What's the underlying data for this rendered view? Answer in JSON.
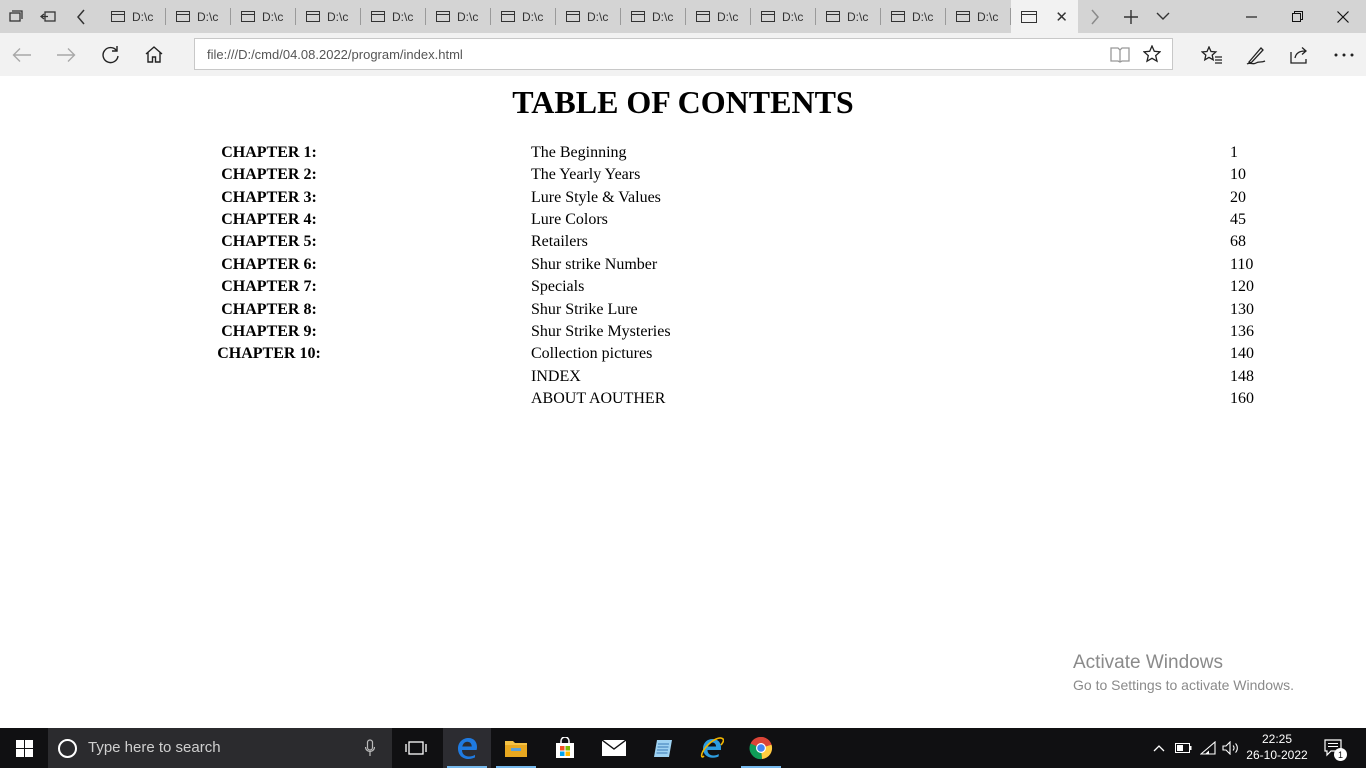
{
  "browser": {
    "tabs": [
      {
        "title": "D:\\c"
      },
      {
        "title": "D:\\c"
      },
      {
        "title": "D:\\c"
      },
      {
        "title": "D:\\c"
      },
      {
        "title": "D:\\c"
      },
      {
        "title": "D:\\c"
      },
      {
        "title": "D:\\c"
      },
      {
        "title": "D:\\c"
      },
      {
        "title": "D:\\c"
      },
      {
        "title": "D:\\c"
      },
      {
        "title": "D:\\c"
      },
      {
        "title": "D:\\c"
      },
      {
        "title": "D:\\c"
      },
      {
        "title": "D:\\c"
      }
    ],
    "active_tab_title": "",
    "address_url": "file:///D:/cmd/04.08.2022/program/index.html"
  },
  "page": {
    "title": "TABLE OF CONTENTS",
    "entries": [
      {
        "chapter": "CHAPTER 1:",
        "title": "The Beginning",
        "page": "1"
      },
      {
        "chapter": "CHAPTER 2:",
        "title": "The Yearly Years",
        "page": "10"
      },
      {
        "chapter": "CHAPTER 3:",
        "title": "Lure Style & Values",
        "page": "20"
      },
      {
        "chapter": "CHAPTER 4:",
        "title": "Lure Colors",
        "page": "45"
      },
      {
        "chapter": "CHAPTER 5:",
        "title": "Retailers",
        "page": "68"
      },
      {
        "chapter": "CHAPTER 6:",
        "title": "Shur strike Number",
        "page": "110"
      },
      {
        "chapter": "CHAPTER 7:",
        "title": "Specials",
        "page": "120"
      },
      {
        "chapter": "CHAPTER 8:",
        "title": "Shur Strike Lure",
        "page": "130"
      },
      {
        "chapter": "CHAPTER 9:",
        "title": "Shur Strike Mysteries",
        "page": "136"
      },
      {
        "chapter": "CHAPTER 10:",
        "title": "Collection pictures",
        "page": "140"
      },
      {
        "chapter": "",
        "title": "INDEX",
        "page": "148"
      },
      {
        "chapter": "",
        "title": "ABOUT AOUTHER",
        "page": "160"
      }
    ]
  },
  "watermark": {
    "line1": "Activate Windows",
    "line2": "Go to Settings to activate Windows."
  },
  "taskbar": {
    "search_placeholder": "Type here to search",
    "time": "22:25",
    "date": "26-10-2022",
    "notification_count": "1",
    "accent_color": "#76b9ed"
  }
}
